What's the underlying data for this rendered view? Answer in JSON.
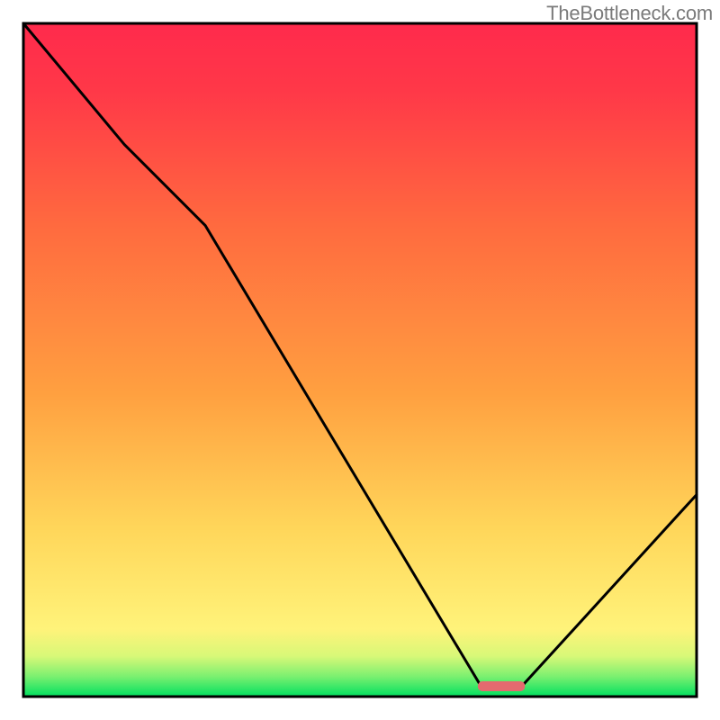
{
  "watermark": "TheBottleneck.com",
  "chart_data": {
    "type": "line",
    "title": "",
    "xlabel": "",
    "ylabel": "",
    "xlim": [
      0,
      100
    ],
    "ylim": [
      0,
      100
    ],
    "background_gradient": {
      "stops": [
        {
          "offset": 0,
          "color": "#00e060"
        },
        {
          "offset": 3,
          "color": "#7cf070"
        },
        {
          "offset": 6,
          "color": "#d8f878"
        },
        {
          "offset": 10,
          "color": "#fff37a"
        },
        {
          "offset": 25,
          "color": "#ffd65a"
        },
        {
          "offset": 45,
          "color": "#ffa040"
        },
        {
          "offset": 70,
          "color": "#ff6a3f"
        },
        {
          "offset": 90,
          "color": "#ff3848"
        },
        {
          "offset": 100,
          "color": "#ff2a4c"
        }
      ]
    },
    "bottleneck_curve": {
      "x": [
        0,
        15,
        27,
        68,
        74,
        100
      ],
      "y": [
        100,
        82,
        70,
        1.5,
        1.5,
        30
      ]
    },
    "sweet_spot_bar": {
      "x_start": 67.5,
      "x_end": 74.5,
      "y": 1.6,
      "color": "#e46a6f"
    }
  }
}
